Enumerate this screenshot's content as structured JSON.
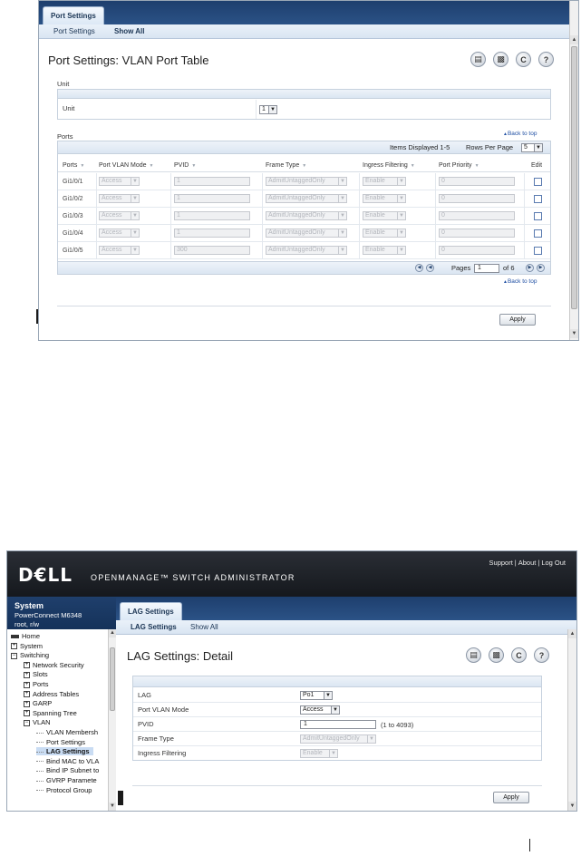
{
  "top": {
    "tab": "Port Settings",
    "subtabs": [
      "Port Settings",
      "Show All"
    ],
    "page_title": "Port Settings: VLAN Port Table",
    "icons": [
      "save-icon",
      "print-icon",
      "refresh-icon",
      "help-icon"
    ],
    "unit_section": {
      "label": "Unit",
      "field_label": "Unit",
      "value": "1"
    },
    "ports_section": {
      "label": "Ports",
      "back_to_top": "Back to top",
      "items_displayed": "Items Displayed 1-5",
      "rows_per_page_label": "Rows Per Page",
      "rows_per_page": "5",
      "columns": [
        "Ports",
        "Port VLAN Mode",
        "PVID",
        "Frame Type",
        "Ingress Filtering",
        "Port Priority",
        "Edit"
      ],
      "rows": [
        {
          "port": "Gi1/0/1",
          "mode": "Access",
          "pvid": "1",
          "frame": "AdmitUntaggedOnly",
          "ingress": "Enable",
          "priority": "0"
        },
        {
          "port": "Gi1/0/2",
          "mode": "Access",
          "pvid": "1",
          "frame": "AdmitUntaggedOnly",
          "ingress": "Enable",
          "priority": "0"
        },
        {
          "port": "Gi1/0/3",
          "mode": "Access",
          "pvid": "1",
          "frame": "AdmitUntaggedOnly",
          "ingress": "Enable",
          "priority": "0"
        },
        {
          "port": "Gi1/0/4",
          "mode": "Access",
          "pvid": "1",
          "frame": "AdmitUntaggedOnly",
          "ingress": "Enable",
          "priority": "0"
        },
        {
          "port": "Gi1/0/5",
          "mode": "Access",
          "pvid": "300",
          "frame": "AdmitUntaggedOnly",
          "ingress": "Enable",
          "priority": "0"
        }
      ],
      "pages_label": "Pages",
      "page": "1",
      "of_pages": "of 6",
      "back_to_top_2": "Back to top"
    },
    "apply": "Apply"
  },
  "bottom": {
    "logo": "D€LL",
    "product": "OPENMANAGE™ SWITCH ADMINISTRATOR",
    "top_links": [
      "Support",
      "About",
      "Log Out"
    ],
    "system_title": "System",
    "system_model": "PowerConnect M6348",
    "system_user": "root, r/w",
    "tree": [
      {
        "label": "Home",
        "level": 0,
        "exp": ""
      },
      {
        "label": "System",
        "level": 0,
        "exp": "+"
      },
      {
        "label": "Switching",
        "level": 0,
        "exp": "-"
      },
      {
        "label": "Network Security",
        "level": 1,
        "exp": "+"
      },
      {
        "label": "Slots",
        "level": 1,
        "exp": "+"
      },
      {
        "label": "Ports",
        "level": 1,
        "exp": "+"
      },
      {
        "label": "Address Tables",
        "level": 1,
        "exp": "+"
      },
      {
        "label": "GARP",
        "level": 1,
        "exp": "+"
      },
      {
        "label": "Spanning Tree",
        "level": 1,
        "exp": "+"
      },
      {
        "label": "VLAN",
        "level": 1,
        "exp": "-"
      },
      {
        "label": "VLAN Membersh",
        "level": 2,
        "exp": ""
      },
      {
        "label": "Port Settings",
        "level": 2,
        "exp": ""
      },
      {
        "label": "LAG Settings",
        "level": 2,
        "exp": "",
        "selected": true
      },
      {
        "label": "Bind MAC to VLA",
        "level": 2,
        "exp": ""
      },
      {
        "label": "Bind IP Subnet to",
        "level": 2,
        "exp": ""
      },
      {
        "label": "GVRP Paramete",
        "level": 2,
        "exp": ""
      },
      {
        "label": "Protocol Group",
        "level": 2,
        "exp": ""
      }
    ],
    "tab": "LAG Settings",
    "subtabs": [
      "LAG Settings",
      "Show All"
    ],
    "page_title": "LAG Settings: Detail",
    "icons": [
      "save-icon",
      "print-icon",
      "refresh-icon",
      "help-icon"
    ],
    "form": {
      "lag_label": "LAG",
      "lag_value": "Po1",
      "mode_label": "Port VLAN Mode",
      "mode_value": "Access",
      "pvid_label": "PVID",
      "pvid_value": "1",
      "pvid_range": "(1 to 4093)",
      "frame_label": "Frame Type",
      "frame_value": "AdmitUntaggedOnly",
      "ingress_label": "Ingress Filtering",
      "ingress_value": "Enable"
    },
    "apply": "Apply"
  }
}
